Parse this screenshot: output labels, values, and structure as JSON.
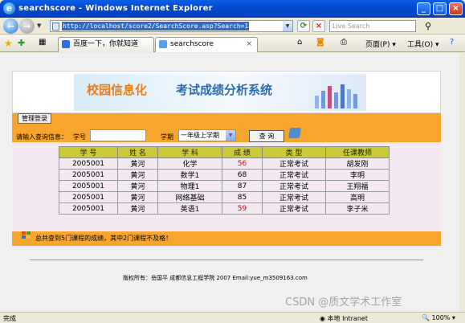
{
  "window": {
    "title": "searchscore - Windows Internet Explorer"
  },
  "address": {
    "url": "http://localhost/score2/SearchScore.asp?Search=1",
    "live_search_placeholder": "Live Search"
  },
  "tabs": [
    {
      "label": "百度一下，你就知道"
    },
    {
      "label": "searchscore"
    }
  ],
  "toolbar": {
    "page_label": "页面(P)",
    "tools_label": "工具(O)"
  },
  "page": {
    "banner_orange": "校园信息化",
    "banner_blue": "考试成绩分析系统",
    "admin_button": "管理登录",
    "query_label": "请输入查询信息：",
    "student_id_label": "学号",
    "student_id_value": "",
    "term_label": "学期",
    "term_value": "一年级上学期",
    "search_button": "查  询",
    "summary": "总共查到5门课程的成绩，其中2门课程不及格！",
    "footer": "版权所有：岳国平  成都信息工程学院  2007  Email:yue_m3509163.com"
  },
  "table": {
    "headers": [
      "学 号",
      "姓 名",
      "学 科",
      "成 绩",
      "类 型",
      "任课教师"
    ],
    "rows": [
      {
        "id": "2005001",
        "name": "黄河",
        "subject": "化学",
        "score": "56",
        "fail": true,
        "type": "正常考试",
        "teacher": "胡发刚"
      },
      {
        "id": "2005001",
        "name": "黄河",
        "subject": "数学1",
        "score": "68",
        "fail": false,
        "type": "正常考试",
        "teacher": "李明"
      },
      {
        "id": "2005001",
        "name": "黄河",
        "subject": "物理1",
        "score": "87",
        "fail": false,
        "type": "正常考试",
        "teacher": "王翔福"
      },
      {
        "id": "2005001",
        "name": "黄河",
        "subject": "网络基础",
        "score": "85",
        "fail": false,
        "type": "正常考试",
        "teacher": "高明"
      },
      {
        "id": "2005001",
        "name": "黄河",
        "subject": "英语1",
        "score": "59",
        "fail": true,
        "type": "正常考试",
        "teacher": "李子米"
      }
    ],
    "fail_color": "#e60000"
  },
  "status": {
    "done": "完成",
    "zone": "本地 Intranet",
    "zoom": "100%",
    "watermark": "CSDN @质文学术工作室"
  }
}
